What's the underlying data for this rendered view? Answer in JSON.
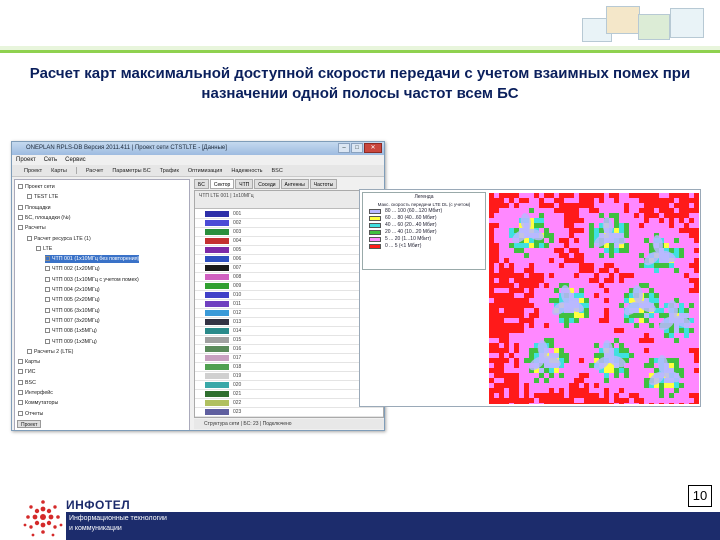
{
  "title": "Расчет карт максимальной доступной скорости передачи с учетом взаимных помех при назначении одной полосы частот всем БС",
  "window": {
    "title": "ONEPLAN RPLS-DB Версия 2011.411 | Проект сети CTSTLTE - [Данные]",
    "menu": [
      "Проект",
      "Сеть",
      "Сервис"
    ],
    "toolbar": [
      "Проект",
      "Карты",
      "Расчет",
      "Параметры БС",
      "Трафик",
      "Оптимизация",
      "Надежность",
      "BSC"
    ]
  },
  "tree": {
    "items": [
      {
        "label": "Проект сети",
        "indent": 0
      },
      {
        "label": "TEST LTE",
        "indent": 1
      },
      {
        "label": "Площадки",
        "indent": 0
      },
      {
        "label": "БС, площадки (№)",
        "indent": 0
      },
      {
        "label": "Расчеты",
        "indent": 0
      },
      {
        "label": "Расчет ресурса LTE (1)",
        "indent": 1
      },
      {
        "label": "LTE",
        "indent": 2
      },
      {
        "label": "ЧТП 001 (1x10МГц без повторения)",
        "indent": 3,
        "selected": true
      },
      {
        "label": "ЧТП 002 (1x20МГц)",
        "indent": 3
      },
      {
        "label": "ЧТП 003 (1x10МГц с учетом помех)",
        "indent": 3
      },
      {
        "label": "ЧТП 004 (2x10МГц)",
        "indent": 3
      },
      {
        "label": "ЧТП 005 (2x20МГц)",
        "indent": 3
      },
      {
        "label": "ЧТП 006 (3x10МГц)",
        "indent": 3
      },
      {
        "label": "ЧТП 007 (3x20МГц)",
        "indent": 3
      },
      {
        "label": "ЧТП 008 (1x5МГц)",
        "indent": 3
      },
      {
        "label": "ЧТП 009 (1x3МГц)",
        "indent": 3
      },
      {
        "label": "Расчеты 2 (LTE)",
        "indent": 1
      },
      {
        "label": "Карты",
        "indent": 0
      },
      {
        "label": "ГИС",
        "indent": 0
      },
      {
        "label": "BSC",
        "indent": 0
      },
      {
        "label": "Интерфейс",
        "indent": 0
      },
      {
        "label": "Коммутаторы",
        "indent": 0
      },
      {
        "label": "Отчеты",
        "indent": 0
      }
    ],
    "bottom_tab": "Проект"
  },
  "grid": {
    "tabs": [
      "БС",
      "Сектор",
      "ЧТП",
      "Соседи",
      "Антенны",
      "Частоты"
    ],
    "header_left": "ЧТП LTE 001 | 1x10МГц",
    "rows": [
      {
        "color": "#2d2fa8",
        "code": "001"
      },
      {
        "color": "#4b4bd6",
        "code": "002"
      },
      {
        "color": "#2a8f3c",
        "code": "003"
      },
      {
        "color": "#c43030",
        "code": "004"
      },
      {
        "color": "#7d2aa8",
        "code": "005"
      },
      {
        "color": "#2d4fc0",
        "code": "006"
      },
      {
        "color": "#1a1a1a",
        "code": "007"
      },
      {
        "color": "#d060c0",
        "code": "008"
      },
      {
        "color": "#30a030",
        "code": "009"
      },
      {
        "color": "#4040c8",
        "code": "010"
      },
      {
        "color": "#7040c0",
        "code": "011"
      },
      {
        "color": "#3a9ad8",
        "code": "012"
      },
      {
        "color": "#333344",
        "code": "013"
      },
      {
        "color": "#2a8a8a",
        "code": "014"
      },
      {
        "color": "#a0a0a0",
        "code": "015"
      },
      {
        "color": "#5a8a5a",
        "code": "016"
      },
      {
        "color": "#c8a0c0",
        "code": "017"
      },
      {
        "color": "#50a050",
        "code": "018"
      },
      {
        "color": "#d0d0d0",
        "code": "019"
      },
      {
        "color": "#3aa8a8",
        "code": "020"
      },
      {
        "color": "#2f6f2f",
        "code": "021"
      },
      {
        "color": "#b0c060",
        "code": "022"
      },
      {
        "color": "#6060a0",
        "code": "023"
      }
    ],
    "status": "Структура сети | БС: 23 | Подключено"
  },
  "legend": {
    "title": "Легенда",
    "subtitle": "Макс. скорость передачи LTE DL (с учетом)",
    "rows": [
      {
        "color": "#b8b8ff",
        "label": "80 ... 100 (60...120 Мбит)"
      },
      {
        "color": "#ffff40",
        "label": "60 ... 80 (40...60 Мбит)"
      },
      {
        "color": "#40e0e0",
        "label": "40 ... 60 (20...40 Мбит)"
      },
      {
        "color": "#40c040",
        "label": "20 ... 40 (10...20 Мбит)"
      },
      {
        "color": "#ff88ff",
        "label": "5 ... 20 (1...10 Мбит)"
      },
      {
        "color": "#ff1a1a",
        "label": "0 ... 5 (<1 Мбит)"
      }
    ]
  },
  "footer": {
    "company": "ИНФОТЕЛ",
    "tagline_line1": "Информационные технологии",
    "tagline_line2": "и коммуникации",
    "page_number": "10"
  }
}
